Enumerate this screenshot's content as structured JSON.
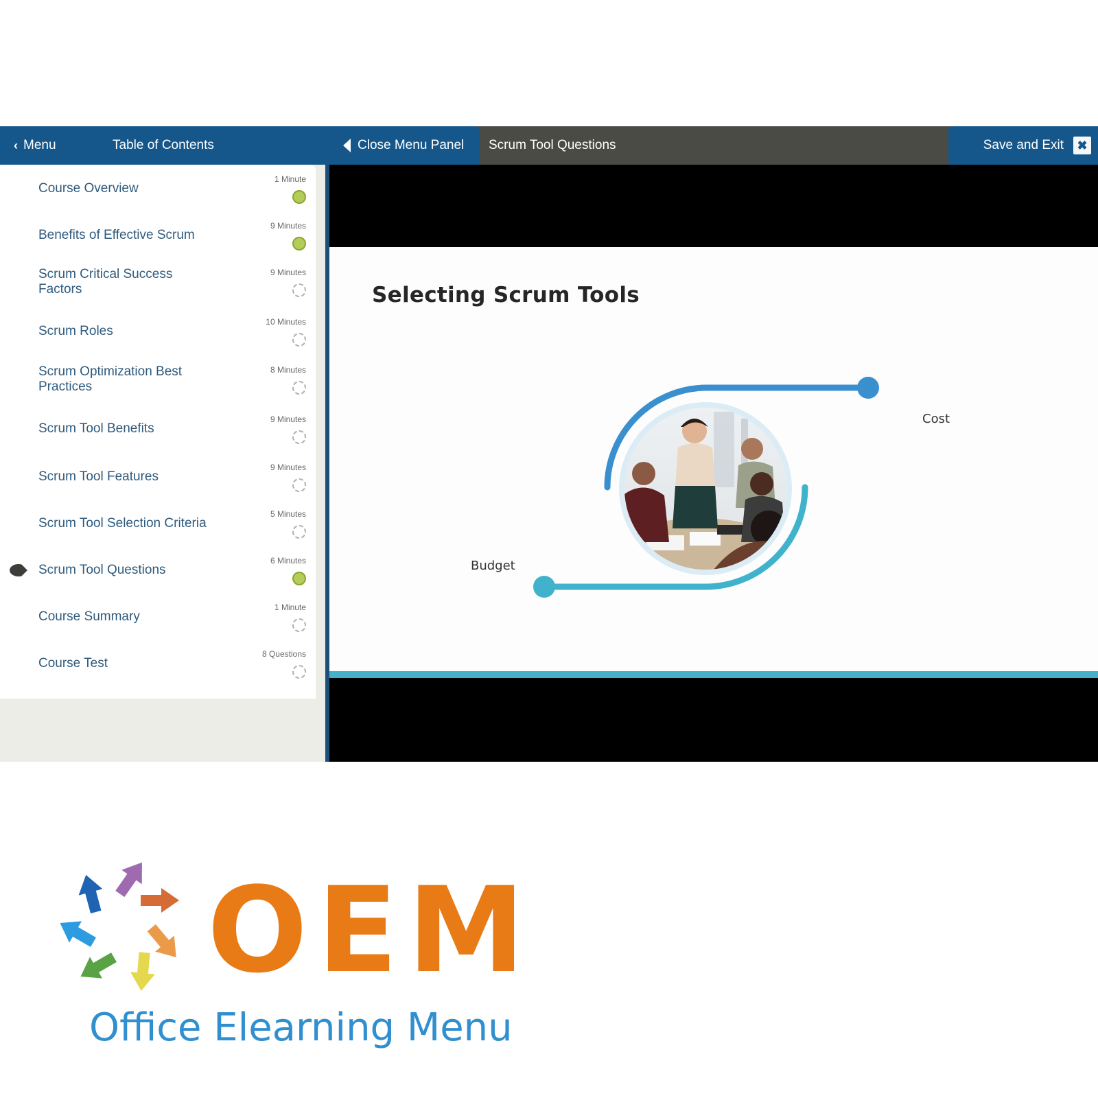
{
  "topbar": {
    "menu_label": "Menu",
    "toc_title": "Table of Contents",
    "close_panel_label": "Close Menu Panel",
    "lesson_title": "Scrum Tool Questions",
    "save_exit_label": "Save and Exit",
    "close_icon_glyph": "✖"
  },
  "colors": {
    "primary_blue": "#15578b",
    "bar_gray": "#4a4b45",
    "complete_green": "#b4cc5a",
    "slide_accent": "#45b0c8",
    "logo_orange": "#e97b16",
    "logo_blue": "#2f8fcf"
  },
  "toc": {
    "items": [
      {
        "label": "Course Overview",
        "duration": "1 Minute",
        "status": "complete",
        "current": false
      },
      {
        "label": "Benefits of Effective Scrum",
        "duration": "9 Minutes",
        "status": "complete",
        "current": false
      },
      {
        "label": "Scrum Critical Success Factors",
        "duration": "9 Minutes",
        "status": "incomplete",
        "current": false
      },
      {
        "label": "Scrum Roles",
        "duration": "10 Minutes",
        "status": "incomplete",
        "current": false
      },
      {
        "label": "Scrum Optimization Best Practices",
        "duration": "8 Minutes",
        "status": "incomplete",
        "current": false
      },
      {
        "label": "Scrum Tool Benefits",
        "duration": "9 Minutes",
        "status": "incomplete",
        "current": false
      },
      {
        "label": "Scrum Tool Features",
        "duration": "9 Minutes",
        "status": "incomplete",
        "current": false
      },
      {
        "label": "Scrum Tool Selection Criteria",
        "duration": "5 Minutes",
        "status": "incomplete",
        "current": false
      },
      {
        "label": "Scrum Tool Questions",
        "duration": "6 Minutes",
        "status": "complete",
        "current": true
      },
      {
        "label": "Course Summary",
        "duration": "1 Minute",
        "status": "incomplete",
        "current": false
      },
      {
        "label": "Course Test",
        "duration": "8 Questions",
        "status": "incomplete",
        "current": false
      }
    ]
  },
  "slide": {
    "title": "Selecting Scrum Tools",
    "labels": {
      "cost": "Cost",
      "budget": "Budget"
    },
    "image_alt": "team-celebrating-photo"
  },
  "logo": {
    "wordmark": "OEM",
    "tagline": "Office Elearning Menu"
  }
}
